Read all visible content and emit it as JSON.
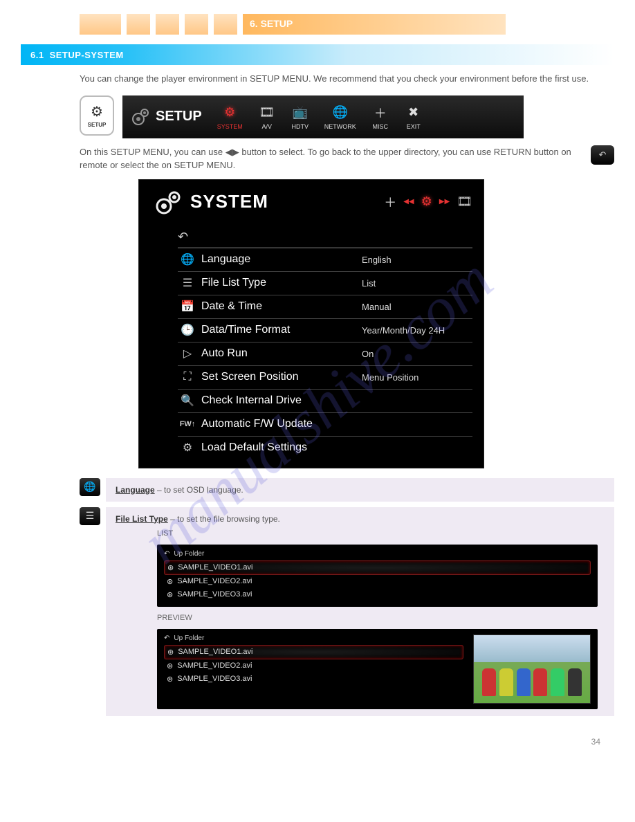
{
  "watermark": "manualshive.com",
  "topbar": {
    "six_label": "6. SETUP"
  },
  "section": {
    "num": "6.1",
    "title": "SETUP-SYSTEM"
  },
  "intro": "You can change the player environment in SETUP MENU. We recommend that you check your environment before the first use.",
  "setup_icon_label": "SETUP",
  "nav": {
    "brand": "SETUP",
    "items": [
      {
        "label": "SYSTEM",
        "active": true
      },
      {
        "label": "A/V"
      },
      {
        "label": "HDTV"
      },
      {
        "label": "NETWORK"
      },
      {
        "label": "MISC"
      },
      {
        "label": "EXIT"
      }
    ]
  },
  "nav_note": "On this SETUP MENU, you can use ◀▶ button to select. To go back to the upper directory, you can use RETURN button on remote or select the",
  "nav_note_tail": "on SETUP MENU.",
  "return_glyph": "↶",
  "panel": {
    "title": "SYSTEM",
    "rows": [
      {
        "icon": "globe",
        "label": "Language",
        "value": "English"
      },
      {
        "icon": "list",
        "label": "File List Type",
        "value": "List"
      },
      {
        "icon": "cal",
        "label": "Date & Time",
        "value": "Manual"
      },
      {
        "icon": "clock",
        "label": "Data/Time Format",
        "value": "Year/Month/Day 24H"
      },
      {
        "icon": "play",
        "label": "Auto Run",
        "value": "On"
      },
      {
        "icon": "screen",
        "label": "Set Screen Position",
        "value": "Menu Position"
      },
      {
        "icon": "search",
        "label": "Check Internal Drive",
        "value": ""
      },
      {
        "icon": "fw",
        "label": "Automatic F/W Update",
        "value": ""
      },
      {
        "icon": "gear",
        "label": "Load Default Settings",
        "value": ""
      }
    ]
  },
  "desc": {
    "language": {
      "title": "Language",
      "text": " – to set OSD language."
    },
    "filelist": {
      "title": "File List Type",
      "text": " – to set the file browsing type.",
      "list_label": "LIST",
      "preview_label": "PREVIEW",
      "up": "Up Folder",
      "files": [
        "SAMPLE_VIDEO1.avi",
        "SAMPLE_VIDEO2.avi",
        "SAMPLE_VIDEO3.avi"
      ]
    }
  },
  "page_number": "34"
}
